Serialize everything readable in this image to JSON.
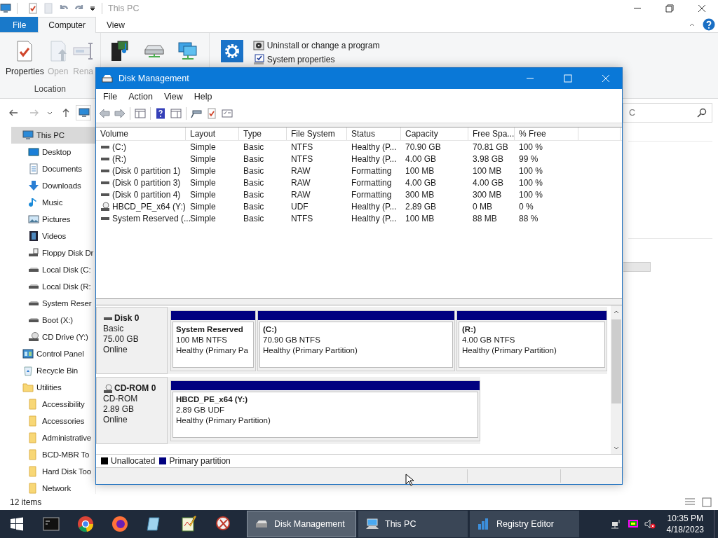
{
  "explorer": {
    "title": "This PC",
    "tabs": [
      {
        "label": "File",
        "kind": "file",
        "selected": false
      },
      {
        "label": "Computer",
        "kind": "tab",
        "selected": true
      },
      {
        "label": "View",
        "kind": "tab",
        "selected": false
      }
    ],
    "ribbon": {
      "location_group": {
        "label": "Location",
        "buttons": [
          {
            "label": "Properties",
            "kind": "properties",
            "disabled": false
          },
          {
            "label": "Open",
            "kind": "open",
            "disabled": true
          },
          {
            "label": "Rena",
            "kind": "rename",
            "disabled": true
          }
        ]
      },
      "network_buttons": [
        {
          "kind": "media"
        },
        {
          "kind": "drive"
        },
        {
          "kind": "network"
        }
      ],
      "system_group": {
        "links": [
          {
            "label": "Uninstall or change a program",
            "kind": "uninstall"
          },
          {
            "label": "System properties",
            "kind": "system"
          }
        ]
      }
    },
    "search": {
      "value": "C"
    },
    "nav": [
      {
        "label": "This PC",
        "kind": "pc",
        "selected": true,
        "children": [
          {
            "label": "Desktop",
            "kind": "desktop",
            "selected": false
          },
          {
            "label": "Documents",
            "kind": "documents",
            "selected": false
          },
          {
            "label": "Downloads",
            "kind": "downloads",
            "selected": false
          },
          {
            "label": "Music",
            "kind": "music",
            "selected": false
          },
          {
            "label": "Pictures",
            "kind": "pictures",
            "selected": false
          },
          {
            "label": "Videos",
            "kind": "videos",
            "selected": false
          },
          {
            "label": "Floppy Disk Dr",
            "kind": "floppy",
            "selected": false
          },
          {
            "label": "Local Disk (C:",
            "kind": "drive",
            "selected": false
          },
          {
            "label": "Local Disk (R:",
            "kind": "drive",
            "selected": false
          },
          {
            "label": "System Reser",
            "kind": "drive",
            "selected": false
          },
          {
            "label": "Boot (X:)",
            "kind": "drive",
            "selected": false
          },
          {
            "label": "CD Drive (Y:)",
            "kind": "cd",
            "selected": false
          }
        ]
      },
      {
        "label": "Control Panel",
        "kind": "control",
        "selected": false
      },
      {
        "label": "Recycle Bin",
        "kind": "recycle",
        "selected": false
      },
      {
        "label": "Utilities",
        "kind": "folder",
        "selected": false,
        "children": [
          {
            "label": "Accessibility",
            "kind": "folder",
            "selected": false
          },
          {
            "label": "Accessories",
            "kind": "folder",
            "selected": false
          },
          {
            "label": "Administrative",
            "kind": "folder",
            "selected": false
          },
          {
            "label": "BCD-MBR To",
            "kind": "folder",
            "selected": false
          },
          {
            "label": "Hard Disk Too",
            "kind": "folder",
            "selected": false
          },
          {
            "label": "Network",
            "kind": "folder",
            "selected": false
          }
        ]
      }
    ],
    "status_bar": "12 items"
  },
  "disk_management": {
    "title": "Disk Management",
    "menu": [
      "File",
      "Action",
      "View",
      "Help"
    ],
    "table": {
      "columns": [
        "Volume",
        "Layout",
        "Type",
        "File System",
        "Status",
        "Capacity",
        "Free Spa...",
        "% Free"
      ],
      "rows": [
        {
          "kind": "disk",
          "cells": [
            "(C:)",
            "Simple",
            "Basic",
            "NTFS",
            "Healthy (P...",
            "70.90 GB",
            "70.81 GB",
            "100 %"
          ]
        },
        {
          "kind": "disk",
          "cells": [
            "(R:)",
            "Simple",
            "Basic",
            "NTFS",
            "Healthy (P...",
            "4.00 GB",
            "3.98 GB",
            "99 %"
          ]
        },
        {
          "kind": "disk",
          "cells": [
            "(Disk 0 partition 1)",
            "Simple",
            "Basic",
            "RAW",
            "Formatting",
            "100 MB",
            "100 MB",
            "100 %"
          ]
        },
        {
          "kind": "disk",
          "cells": [
            "(Disk 0 partition 3)",
            "Simple",
            "Basic",
            "RAW",
            "Formatting",
            "4.00 GB",
            "4.00 GB",
            "100 %"
          ]
        },
        {
          "kind": "disk",
          "cells": [
            "(Disk 0 partition 4)",
            "Simple",
            "Basic",
            "RAW",
            "Formatting",
            "300 MB",
            "300 MB",
            "100 %"
          ]
        },
        {
          "kind": "cd",
          "cells": [
            "HBCD_PE_x64 (Y:)",
            "Simple",
            "Basic",
            "UDF",
            "Healthy (P...",
            "2.89 GB",
            "0 MB",
            "0 %"
          ]
        },
        {
          "kind": "disk",
          "cells": [
            "System Reserved (...",
            "Simple",
            "Basic",
            "NTFS",
            "Healthy (P...",
            "100 MB",
            "88 MB",
            "88 %"
          ]
        }
      ]
    },
    "disks": [
      {
        "kind": "disk",
        "name": "Disk 0",
        "lines": [
          "Basic",
          "75.00 GB",
          "Online"
        ],
        "partitions": [
          {
            "name": "System Reserved",
            "size": "100 MB NTFS",
            "status": "Healthy (Primary Pa"
          },
          {
            "name": "(C:)",
            "size": "70.90 GB NTFS",
            "status": "Healthy (Primary Partition)"
          },
          {
            "name": "(R:)",
            "size": "4.00 GB NTFS",
            "status": "Healthy (Primary Partition)"
          }
        ]
      },
      {
        "kind": "cd",
        "name": "CD-ROM 0",
        "lines": [
          "CD-ROM",
          "2.89 GB",
          "Online"
        ],
        "partitions": [
          {
            "name": "HBCD_PE_x64  (Y:)",
            "size": "2.89 GB UDF",
            "status": "Healthy (Primary Partition)"
          }
        ]
      }
    ],
    "legend": [
      {
        "label": "Unallocated",
        "color": "#000000"
      },
      {
        "label": "Primary partition",
        "color": "#000080"
      }
    ]
  },
  "taskbar": {
    "pinned": [
      {
        "kind": "terminal"
      },
      {
        "kind": "chrome"
      },
      {
        "kind": "firefox"
      },
      {
        "kind": "notepad"
      },
      {
        "kind": "editor"
      },
      {
        "kind": "snip"
      }
    ],
    "windows": [
      {
        "label": "Disk Management",
        "kind": "disk",
        "selected": true
      },
      {
        "label": "This PC",
        "kind": "pc",
        "selected": false
      },
      {
        "label": "Registry Editor",
        "kind": "registry",
        "selected": false
      }
    ],
    "time": "10:35 PM",
    "date": "4/18/2023"
  }
}
